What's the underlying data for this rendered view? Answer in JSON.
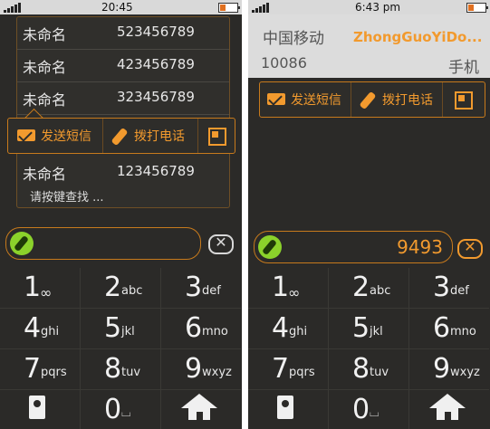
{
  "left": {
    "status": {
      "time": "20:45"
    },
    "contacts": [
      {
        "name": "未命名",
        "number": "523456789"
      },
      {
        "name": "未命名",
        "number": "423456789"
      },
      {
        "name": "未命名",
        "number": "323456789"
      },
      {
        "name": "未命名",
        "number": "123456789"
      }
    ],
    "hint": "请按键查找 ...",
    "actions": {
      "sms": "发送短信",
      "call": "拨打电话"
    },
    "input_value": ""
  },
  "right": {
    "status": {
      "time": "6:43  pm"
    },
    "operator": {
      "name_cn": "中国移动",
      "name_pinyin": "ZhongGuoYiDo...",
      "number": "10086",
      "type": "手机"
    },
    "actions": {
      "sms": "发送短信",
      "call": "拨打电话"
    },
    "input_value": "9493"
  },
  "keypad": [
    {
      "digit": "1",
      "letters": "∞"
    },
    {
      "digit": "2",
      "letters": "abc"
    },
    {
      "digit": "3",
      "letters": "def"
    },
    {
      "digit": "4",
      "letters": "ghi"
    },
    {
      "digit": "5",
      "letters": "jkl"
    },
    {
      "digit": "6",
      "letters": "mno"
    },
    {
      "digit": "7",
      "letters": "pqrs"
    },
    {
      "digit": "8",
      "letters": "tuv"
    },
    {
      "digit": "9",
      "letters": "wxyz"
    },
    {
      "digit": "0",
      "letters": "⌴"
    }
  ],
  "icons": {
    "contacts": "contacts-icon",
    "home": "home-icon",
    "clear": "clear-icon",
    "call": "phone-icon"
  },
  "colors": {
    "accent": "#f29a2e",
    "bg": "#2b2a28",
    "call_green": "#8bd22b"
  }
}
